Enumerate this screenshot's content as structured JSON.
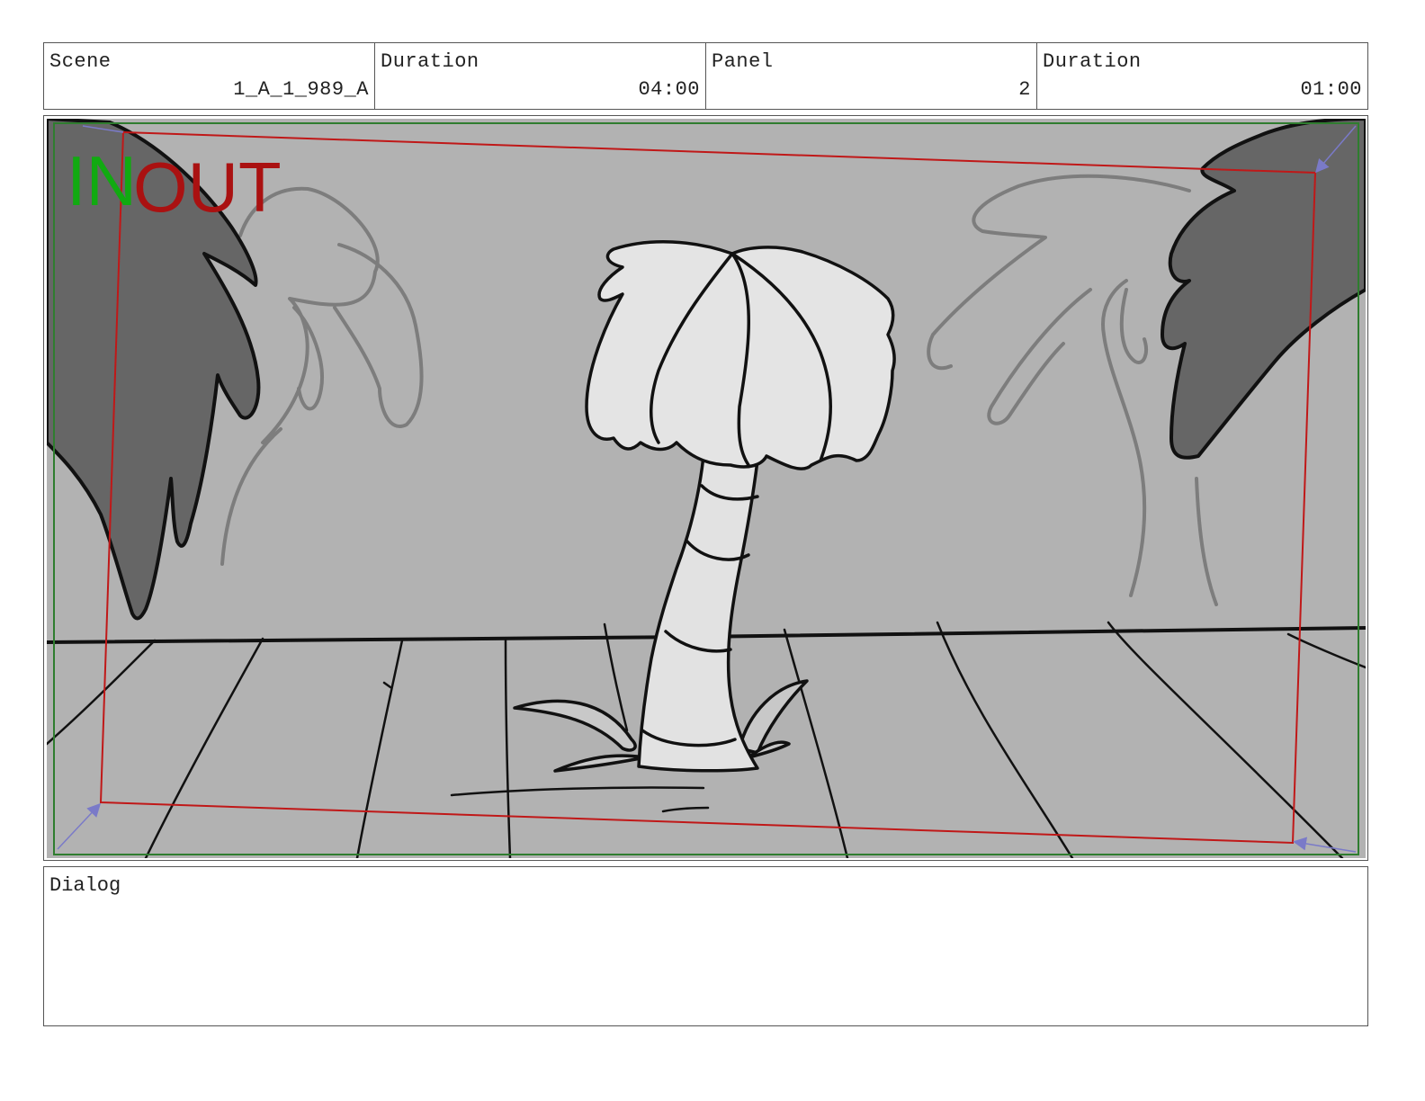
{
  "header": {
    "cells": [
      {
        "label": "Scene",
        "value": "1_A_1_989_A"
      },
      {
        "label": "Duration",
        "value": "04:00"
      },
      {
        "label": "Panel",
        "value": "2"
      },
      {
        "label": "Duration",
        "value": "01:00"
      }
    ]
  },
  "panel": {
    "in_label": "IN",
    "out_label": "OUT",
    "colors": {
      "background": "#b2b2b2",
      "in_marker": "#11aa11",
      "out_marker": "#aa1111",
      "safe_frame": "#2f7d2f",
      "camera_frame": "#c01818",
      "camera_arrows": "#7a7ac8",
      "foreground_leaves": "#666666",
      "background_trees": "#8a8a8a",
      "center_tree": "#e6e6e6"
    },
    "icons": [
      "palm-tree-sketch",
      "camera-move-arrow"
    ]
  },
  "dialog": {
    "label": "Dialog",
    "text": ""
  }
}
